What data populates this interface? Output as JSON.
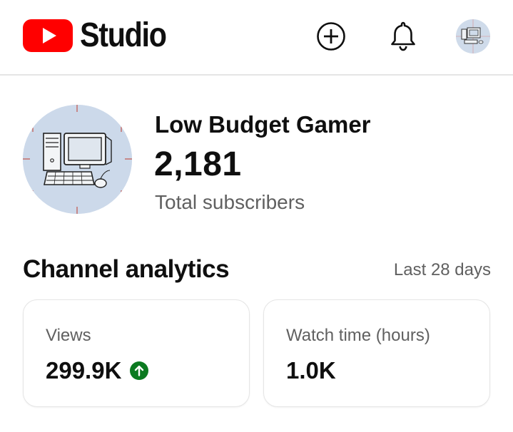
{
  "header": {
    "app_name": "Studio",
    "icons": {
      "logo": "youtube-play-logo",
      "create": "plus-circle-icon",
      "notifications": "bell-icon",
      "account": "account-avatar"
    },
    "brand_color": "#ff0000"
  },
  "channel": {
    "name": "Low Budget Gamer",
    "subscriber_count": "2,181",
    "subscriber_label": "Total subscribers",
    "avatar": "retro-computer-drawing"
  },
  "analytics": {
    "title": "Channel analytics",
    "period": "Last 28 days",
    "cards": [
      {
        "label": "Views",
        "value": "299.9K",
        "trend": "up",
        "trend_color": "#0b7a20"
      },
      {
        "label": "Watch time (hours)",
        "value": "1.0K"
      }
    ]
  }
}
